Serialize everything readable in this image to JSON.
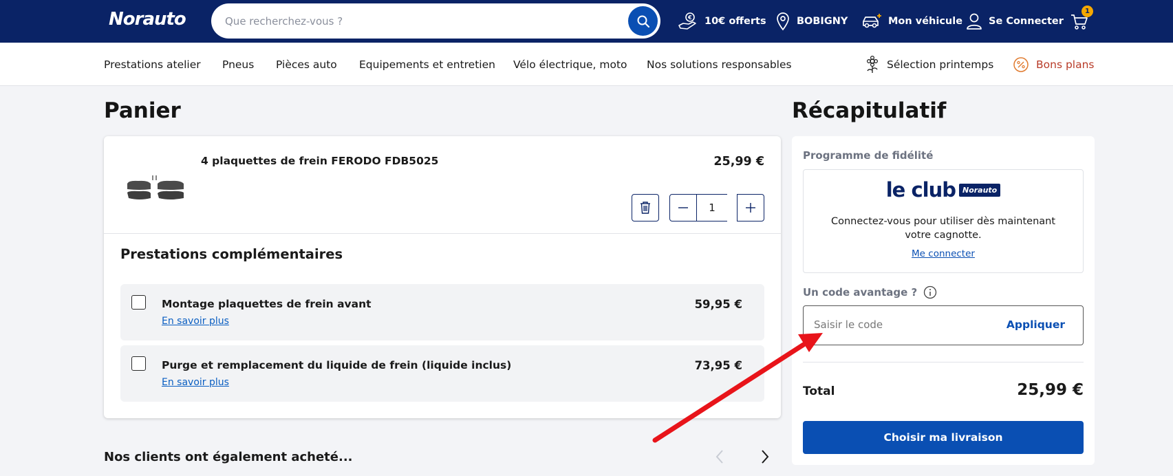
{
  "header": {
    "logo_main": "Norauto",
    "search_placeholder": "Que recherchez-vous ?",
    "offer_label": "10€ offerts",
    "store_label": "BOBIGNY",
    "vehicle_label": "Mon véhicule",
    "login_label": "Se Connecter",
    "cart_count": "1"
  },
  "nav": {
    "items": [
      "Prestations atelier",
      "Pneus",
      "Pièces auto",
      "Equipements et entretien",
      "Vélo électrique, moto",
      "Nos solutions responsables"
    ],
    "spring_label": "Sélection printemps",
    "deals_label": "Bons plans"
  },
  "cart": {
    "title": "Panier",
    "product": {
      "name": "4 plaquettes de frein FERODO FDB5025",
      "price": "25,99 €",
      "quantity": "1"
    },
    "services_title": "Prestations complémentaires",
    "services": [
      {
        "name": "Montage plaquettes de frein avant",
        "link": "En savoir plus",
        "price": "59,95 €",
        "checked": false
      },
      {
        "name": "Purge et remplacement du liquide de frein (liquide inclus)",
        "link": "En savoir plus",
        "price": "73,95 €",
        "checked": false
      }
    ],
    "also_bought": "Nos clients ont également acheté..."
  },
  "summary": {
    "title": "Récapitulatif",
    "loyalty_label": "Programme de fidélité",
    "club_text": "le club",
    "club_tag": "Norauto",
    "club_description": "Connectez-vous pour utiliser dès maintenant votre cagnotte.",
    "club_link": "Me connecter",
    "code_label": "Un code avantage ?",
    "code_placeholder": "Saisir le code",
    "apply_label": "Appliquer",
    "total_label": "Total",
    "total_value": "25,99 €",
    "cta_label": "Choisir ma livraison"
  },
  "colors": {
    "header_bg": "#0a2366",
    "primary": "#0a4fb3",
    "accent": "#f5a800",
    "deals": "#b83b28",
    "annotation_arrow": "#e8141a"
  }
}
